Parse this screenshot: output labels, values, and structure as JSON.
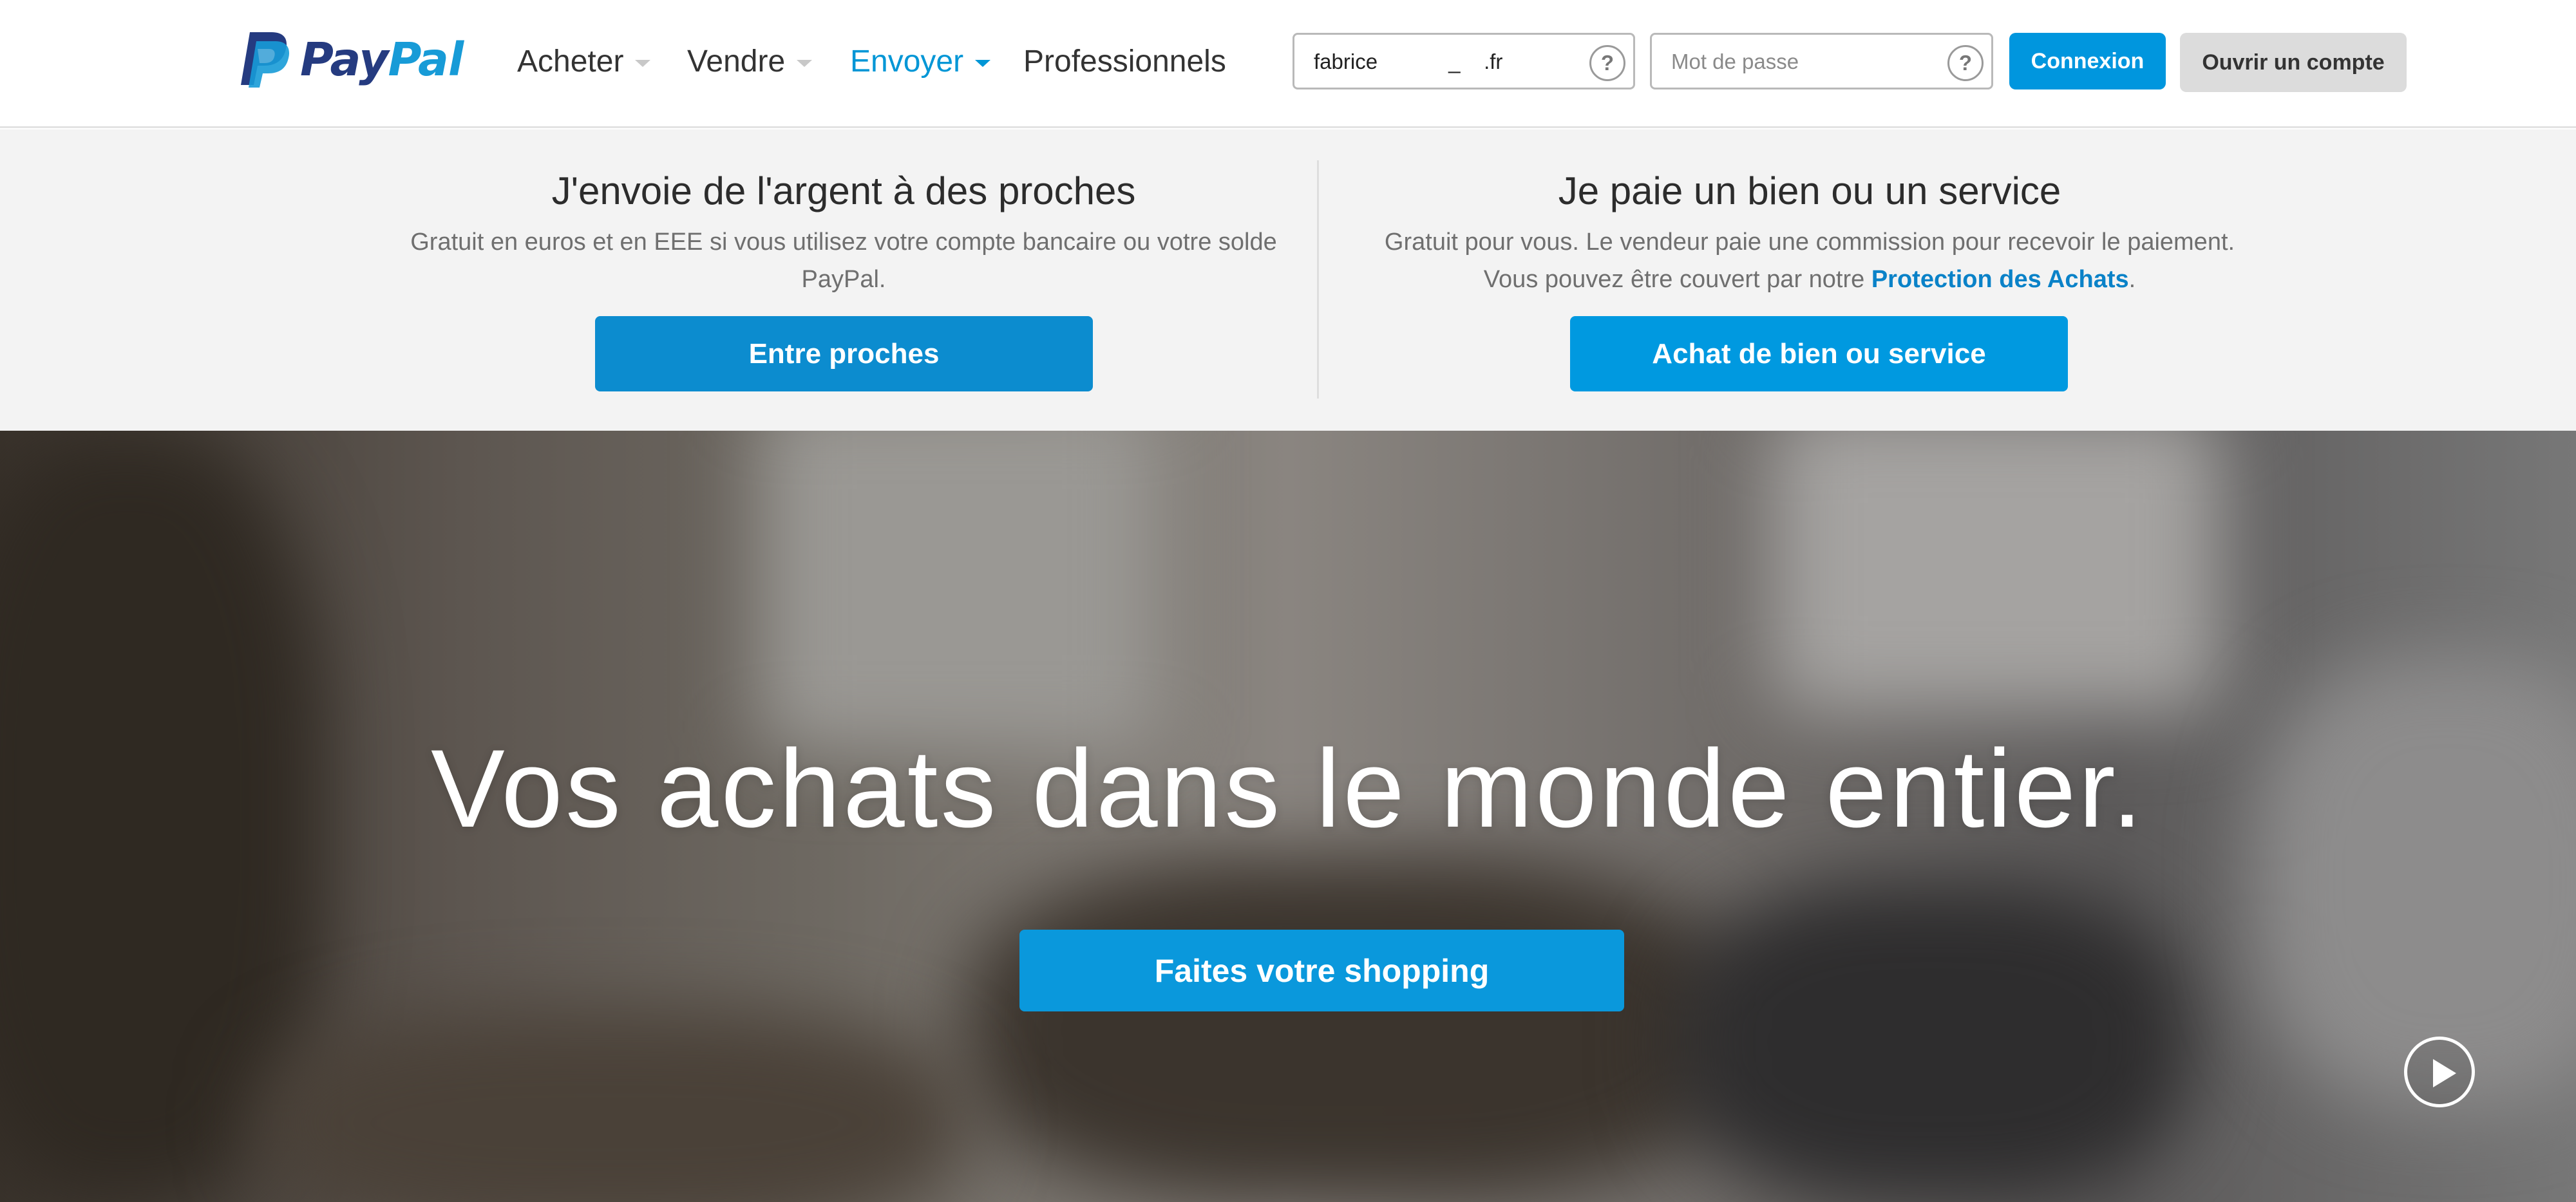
{
  "brand": {
    "pay": "Pay",
    "pal": "Pal",
    "logo_icon": "paypal-p-logo"
  },
  "nav": [
    {
      "label": "Acheter",
      "has_dropdown": true,
      "active": false
    },
    {
      "label": "Vendre",
      "has_dropdown": true,
      "active": false
    },
    {
      "label": "Envoyer",
      "has_dropdown": true,
      "active": true
    },
    {
      "label": "Professionnels",
      "has_dropdown": false,
      "active": false
    }
  ],
  "login": {
    "email_value": "fabrice            _    .fr",
    "password_placeholder": "Mot de passe",
    "help_glyph": "?",
    "login_button": "Connexion",
    "signup_button": "Ouvrir un compte"
  },
  "send_panel": {
    "friends": {
      "title": "J'envoie de l'argent à des proches",
      "desc_line1": "Gratuit en euros et en EEE si vous utilisez votre compte bancaire ou votre solde",
      "desc_line2": "PayPal.",
      "button": "Entre proches"
    },
    "goods": {
      "title": "Je paie un bien ou un service",
      "desc_line1": "Gratuit pour vous. Le vendeur paie une commission pour recevoir le paiement.",
      "desc_line2_prefix": "Vous pouvez être couvert par notre ",
      "desc_link": "Protection des Achats",
      "desc_line2_suffix": ".",
      "button": "Achat de bien ou service"
    }
  },
  "hero": {
    "title": "Vos achats dans le monde entier.",
    "cta": "Faites votre shopping",
    "play_icon": "play-icon"
  },
  "colors": {
    "brand_dark": "#253b80",
    "brand_light": "#179bd7",
    "accent": "#0096de",
    "link": "#0a82c8"
  }
}
